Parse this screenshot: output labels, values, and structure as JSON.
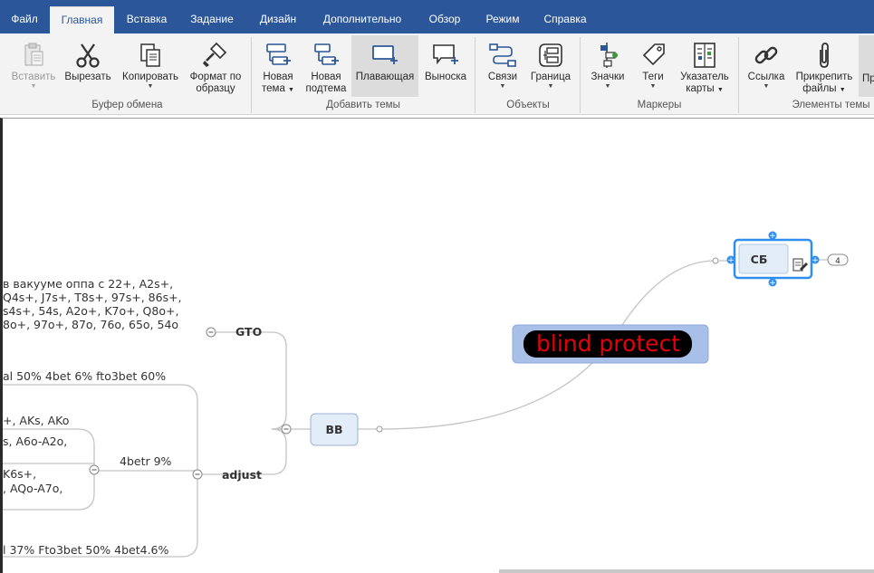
{
  "tabs": [
    {
      "label": "Файл"
    },
    {
      "label": "Главная"
    },
    {
      "label": "Вставка"
    },
    {
      "label": "Задание"
    },
    {
      "label": "Дизайн"
    },
    {
      "label": "Дополнительно"
    },
    {
      "label": "Обзор"
    },
    {
      "label": "Режим"
    },
    {
      "label": "Справка"
    }
  ],
  "ribbon": {
    "paste": {
      "label": "Вставить"
    },
    "cut": {
      "label": "Вырезать"
    },
    "copy": {
      "label": "Копировать"
    },
    "format": {
      "label1": "Формат по",
      "label2": "образцу"
    },
    "new_topic": {
      "label1": "Новая",
      "label2": "тема"
    },
    "new_subtopic": {
      "label1": "Новая",
      "label2": "подтема"
    },
    "floating": {
      "label": "Плавающая"
    },
    "callout": {
      "label": "Выноска"
    },
    "links": {
      "label": "Связи"
    },
    "boundary": {
      "label": "Граница"
    },
    "icons": {
      "label": "Значки"
    },
    "tags": {
      "label": "Теги"
    },
    "map_index": {
      "label1": "Указатель",
      "label2": "карты"
    },
    "hyperlink": {
      "label": "Ссылка"
    },
    "attach": {
      "label1": "Прикрепить",
      "label2": "файлы"
    },
    "more": {
      "label": "Пр"
    },
    "groups": {
      "clipboard": "Буфер обмена",
      "add_topics": "Добавить темы",
      "objects": "Объекты",
      "markers": "Маркеры",
      "topic_elements": "Элементы темы"
    }
  },
  "map": {
    "root": "ВВ",
    "gto_label": "GTO",
    "adjust_label": "adjust",
    "gto_lines": [
      "в вакууме оппа с 22+, A2s+,",
      "Q4s+, J7s+, T8s+, 97s+, 86s+,",
      "s4s+, 54s, A2o+, K7o+, Q8o+,",
      "8o+, 97o+, 87o, 76o, 65o, 54o"
    ],
    "adjust_top": "al 50% 4bet 6% fto3bet 60%",
    "adjust_bottom": "l 37% Fto3bet 50% 4bet4.6%",
    "fourbet_label": "4betr 9%",
    "fourbet_a1": "+, AKs, AKo",
    "fourbet_a2": "s, A6o-A2o,",
    "fourbet_b1": "K6s+,",
    "fourbet_b2": ", AQo-A7o,",
    "floating_topic": "blind protect",
    "sb_topic": "СБ",
    "sb_badge": "4"
  },
  "colors": {
    "tab_bar": "#2b579a",
    "ribbon_bg": "#f3f3f3",
    "selection_blue": "#2f8ff0",
    "floating_bg": "#a8c0e8",
    "floating_text": "#e4000b"
  }
}
